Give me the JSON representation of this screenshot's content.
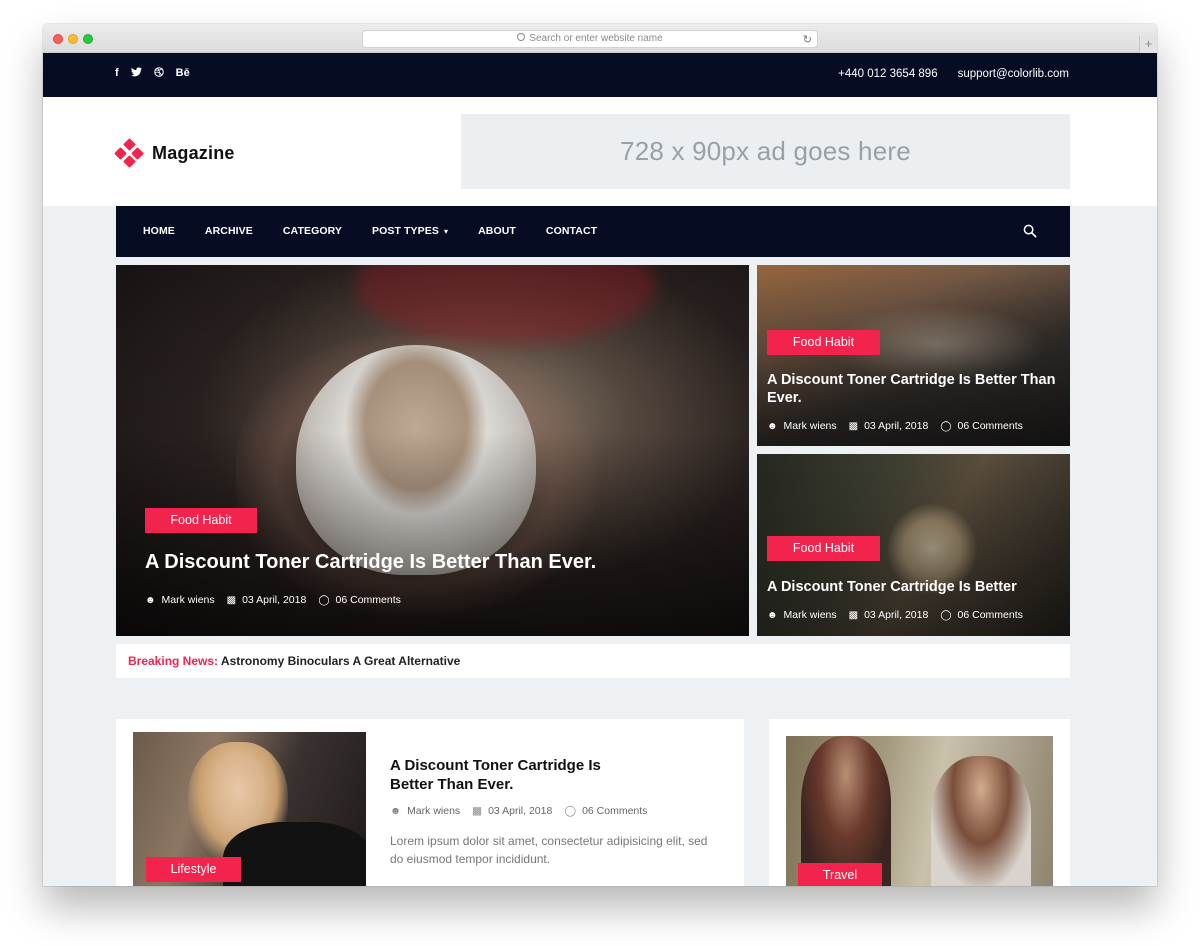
{
  "browser": {
    "address_placeholder": "Search or enter website name"
  },
  "topbar": {
    "social": [
      "f",
      "t",
      "d",
      "Bē"
    ],
    "social_icons": [
      "facebook-icon",
      "twitter-icon",
      "dribbble-icon",
      "behance-icon"
    ],
    "phone": "+440 012 3654 896",
    "email": "support@colorlib.com"
  },
  "header": {
    "logo_text": "Magazine",
    "ad_text": "728 x 90px ad goes here"
  },
  "nav": {
    "items": [
      "HOME",
      "ARCHIVE",
      "CATEGORY",
      "POST TYPES",
      "ABOUT",
      "CONTACT"
    ]
  },
  "hero": {
    "main": {
      "tag": "Food Habit",
      "title": "A Discount Toner Cartridge Is Better Than Ever.",
      "author": "Mark wiens",
      "date": "03 April, 2018",
      "comments": "06 Comments"
    },
    "side1": {
      "tag": "Food Habit",
      "title": "A Discount Toner Cartridge Is Better Than Ever.",
      "author": "Mark wiens",
      "date": "03 April, 2018",
      "comments": "06 Comments"
    },
    "side2": {
      "tag": "Food Habit",
      "title": "A Discount Toner Cartridge Is Better",
      "author": "Mark wiens",
      "date": "03 April, 2018",
      "comments": "06 Comments"
    }
  },
  "breaking": {
    "label": "Breaking News:",
    "text": "Astronomy Binoculars A Great Alternative"
  },
  "posts": {
    "main": {
      "tag": "Lifestyle",
      "title": "A Discount Toner Cartridge Is Better Than Ever.",
      "author": "Mark wiens",
      "date": "03 April, 2018",
      "comments": "06 Comments",
      "excerpt": "Lorem ipsum dolor sit amet, consectetur adipisicing elit, sed do eiusmod tempor incididunt."
    },
    "side": {
      "tag": "Travel"
    }
  },
  "colors": {
    "accent": "#f2234d",
    "dark": "#070c25",
    "page_bg": "#eef1f3"
  }
}
